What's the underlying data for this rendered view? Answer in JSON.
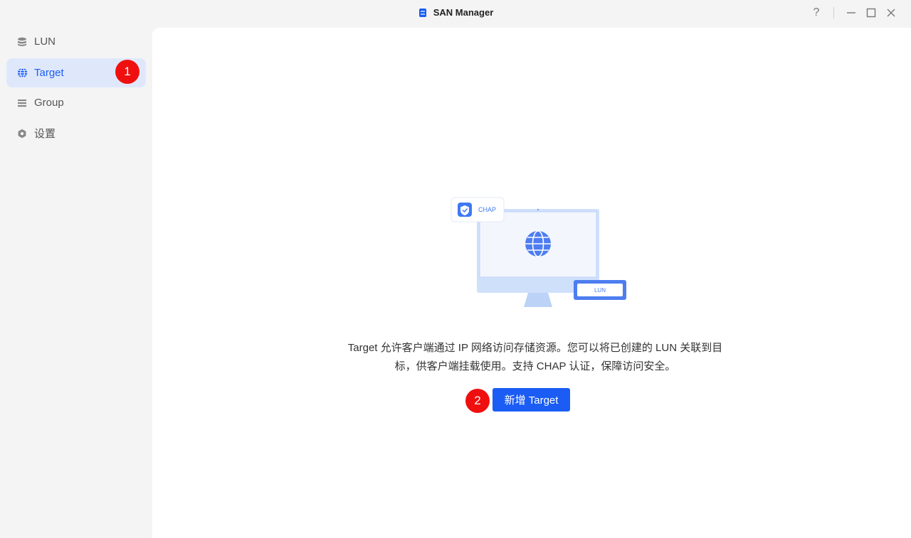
{
  "window": {
    "title": "SAN Manager",
    "help_label": "?",
    "minimize_label": "—",
    "maximize_label": "☐",
    "close_label": "✕"
  },
  "sidebar": {
    "items": [
      {
        "label": "LUN",
        "icon": "database-icon"
      },
      {
        "label": "Target",
        "icon": "globe-icon",
        "active": true
      },
      {
        "label": "Group",
        "icon": "list-icon"
      },
      {
        "label": "设置",
        "icon": "gear-icon"
      }
    ]
  },
  "annotations": {
    "step1": "1",
    "step2": "2"
  },
  "illustration": {
    "chap_label": "CHAP",
    "lun_label": "LUN"
  },
  "main": {
    "description_line1": "Target 允许客户端通过 IP 网络访问存储资源。您可以将已创建的 LUN 关联到目",
    "description_line2": "标，供客户端挂载使用。支持 CHAP 认证，保障访问安全。",
    "create_button_label": "新增 Target"
  },
  "colors": {
    "accent": "#1a5cf4",
    "annotation": "#f00f0f",
    "active_bg": "#dfe8fb"
  }
}
